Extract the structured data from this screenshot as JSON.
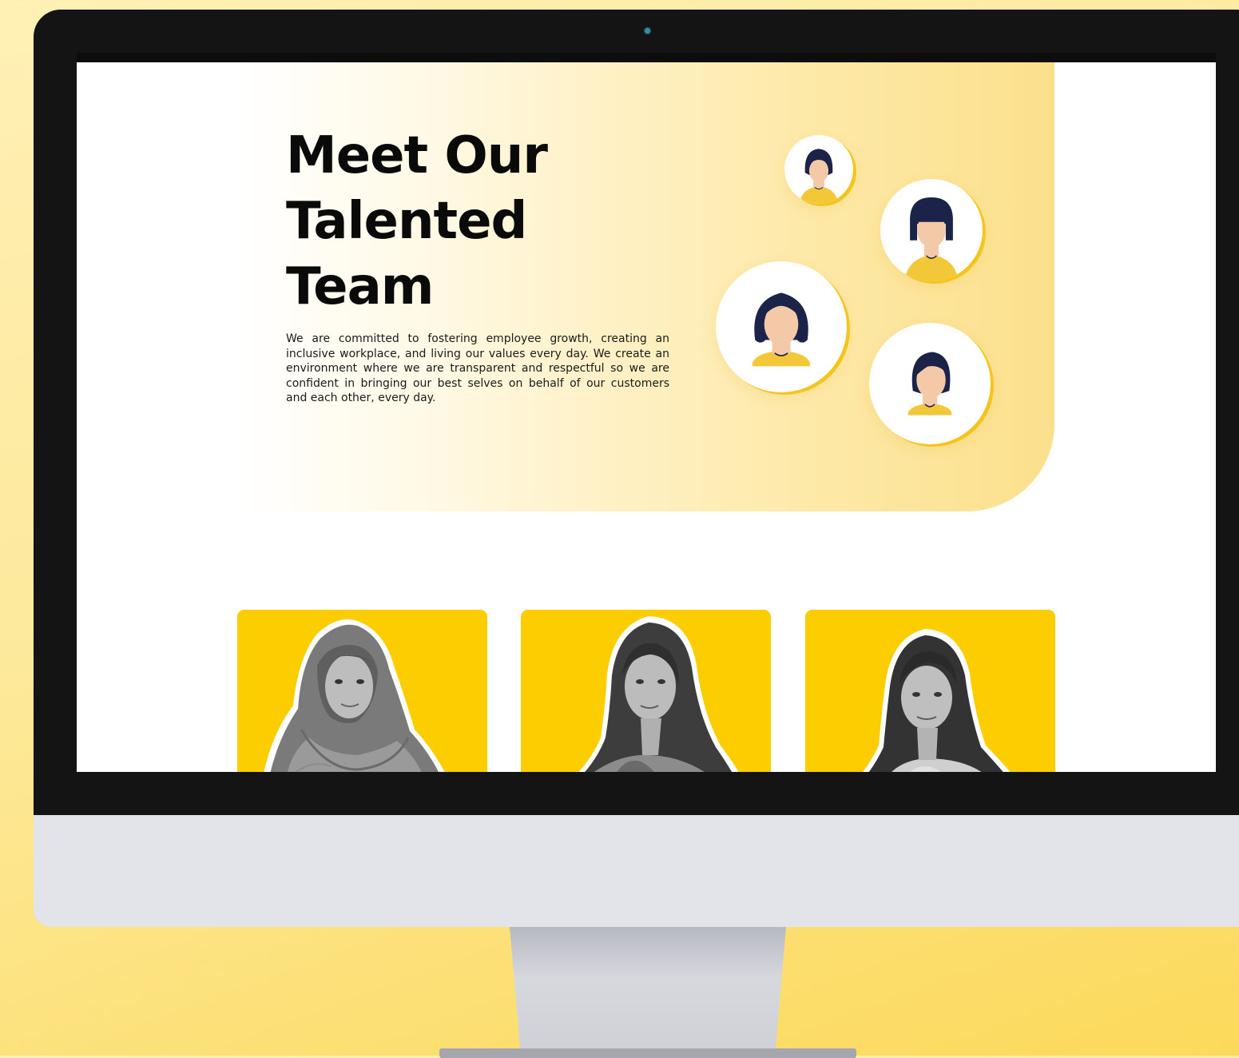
{
  "hero": {
    "title_lines": [
      "Meet Our",
      "Talented",
      "Team"
    ],
    "description": "We are committed to fostering employee growth, creating an inclusive workplace, and living our values every day. We create an environment where we are transparent and respectful so we are confident in bringing our best selves on behalf of our customers and each other, every day."
  },
  "avatars": [
    {
      "icon": "woman-avatar-icon",
      "hair": "short-bob"
    },
    {
      "icon": "woman-avatar-icon",
      "hair": "bangs-bob"
    },
    {
      "icon": "woman-avatar-icon",
      "hair": "long-wavy"
    },
    {
      "icon": "woman-avatar-icon",
      "hair": "side-part"
    }
  ],
  "team_members": [
    {
      "photo": "team-member-photo-hijab"
    },
    {
      "photo": "team-member-photo-long-hair"
    },
    {
      "photo": "team-member-photo-shoulder-hair"
    }
  ],
  "colors": {
    "brand_yellow": "#fccd01",
    "avatar_ring": "#f5c51d",
    "avatar_hair": "#1c2349",
    "avatar_skin": "#f4c9a8",
    "avatar_shirt": "#f2c738",
    "bezel": "#141414",
    "chin": "#e3e4ea"
  }
}
